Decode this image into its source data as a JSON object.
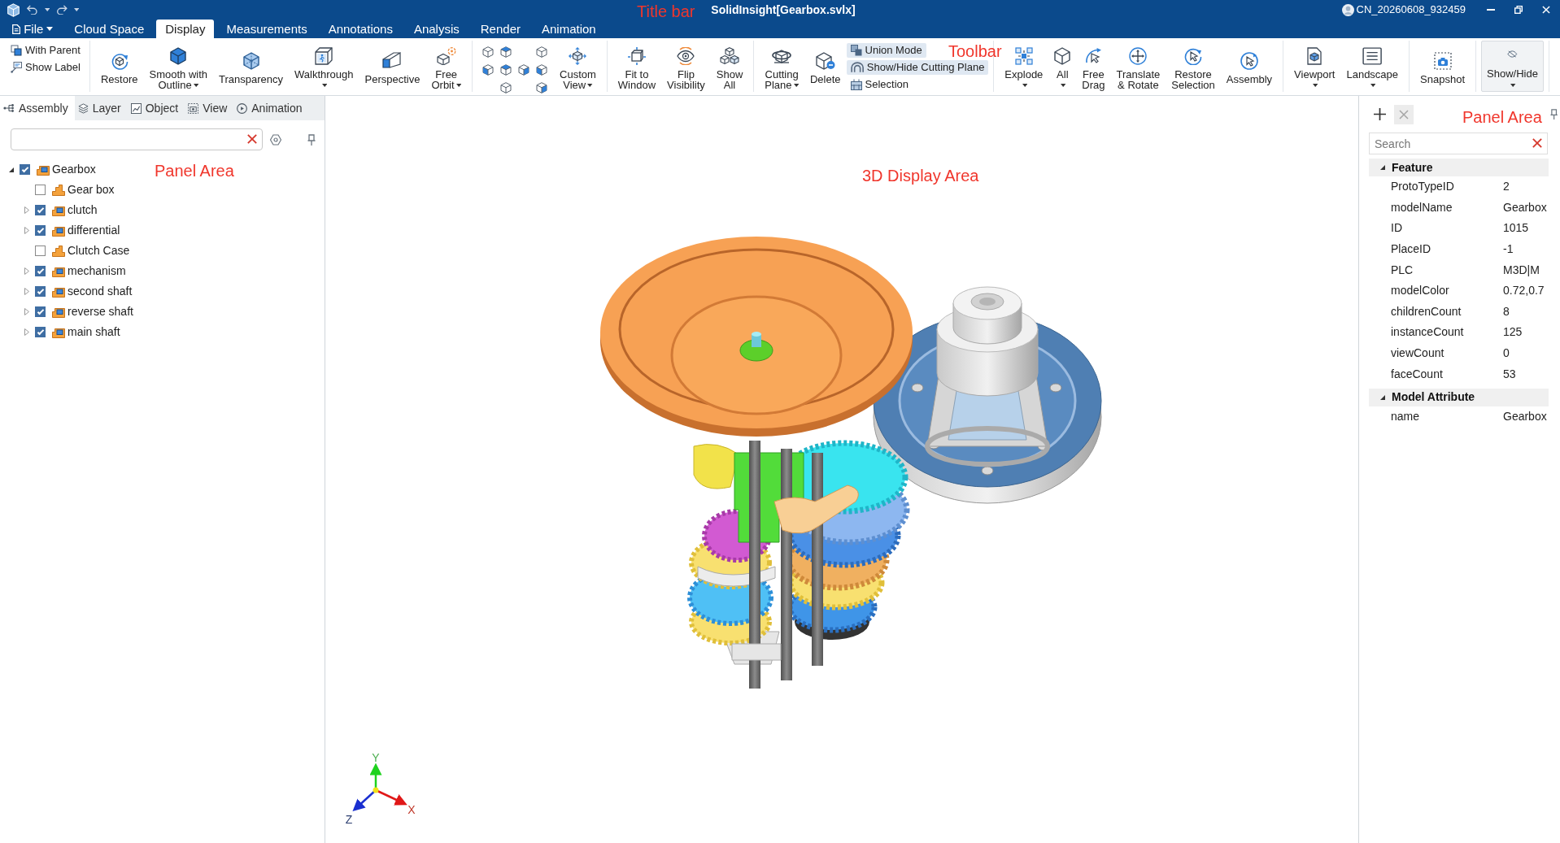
{
  "title_bar": {
    "title": "SolidInsight[Gearbox.svlx]",
    "user": "CN_20260608_932459",
    "annotation": "Title bar"
  },
  "menu_tabs": [
    {
      "label": "File",
      "kind": "file",
      "selected": false
    },
    {
      "label": "Cloud Space",
      "kind": "tab",
      "selected": false
    },
    {
      "label": "Display",
      "kind": "tab",
      "selected": true
    },
    {
      "label": "Measurements",
      "kind": "tab",
      "selected": false
    },
    {
      "label": "Annotations",
      "kind": "tab",
      "selected": false
    },
    {
      "label": "Analysis",
      "kind": "tab",
      "selected": false
    },
    {
      "label": "Render",
      "kind": "tab",
      "selected": false
    },
    {
      "label": "Animation",
      "kind": "tab",
      "selected": false
    }
  ],
  "toolbar": {
    "annotation": "Toolbar",
    "groups": [
      {
        "items": [
          {
            "kind": "small",
            "label": "With Parent",
            "on": false
          },
          {
            "kind": "small",
            "label": "Show Label",
            "on": false
          }
        ]
      },
      {
        "items": [
          {
            "kind": "large",
            "lines": [
              "Restore"
            ],
            "dropdown": false,
            "on": false
          },
          {
            "kind": "large",
            "lines": [
              "Smooth with",
              "Outline"
            ],
            "dropdown": true,
            "on": false
          },
          {
            "kind": "large",
            "lines": [
              "Transparency"
            ],
            "dropdown": false,
            "on": false
          },
          {
            "kind": "large",
            "lines": [
              "Walkthrough"
            ],
            "dropdown": true,
            "on": false
          },
          {
            "kind": "large",
            "lines": [
              "Perspective"
            ],
            "dropdown": false,
            "on": false
          },
          {
            "kind": "large",
            "lines": [
              "Free",
              "Orbit"
            ],
            "dropdown": true,
            "on": false
          }
        ]
      },
      {
        "items": [
          {
            "kind": "view-grid"
          },
          {
            "kind": "large",
            "lines": [
              "Custom",
              "View"
            ],
            "dropdown": true,
            "on": false
          }
        ]
      },
      {
        "items": [
          {
            "kind": "large",
            "lines": [
              "Fit to",
              "Window"
            ],
            "dropdown": false,
            "on": false
          },
          {
            "kind": "large",
            "lines": [
              "Flip",
              "Visibility"
            ],
            "dropdown": false,
            "on": false
          },
          {
            "kind": "large",
            "lines": [
              "Show",
              "All"
            ],
            "dropdown": false,
            "on": false
          }
        ]
      },
      {
        "items": [
          {
            "kind": "large",
            "lines": [
              "Cutting",
              "Plane"
            ],
            "dropdown": true,
            "on": false
          },
          {
            "kind": "large",
            "lines": [
              "Delete"
            ],
            "dropdown": false,
            "on": false
          },
          {
            "kind": "small",
            "label": "Union Mode",
            "on": true
          },
          {
            "kind": "small",
            "label": "Show/Hide Cutting Plane",
            "on": true
          },
          {
            "kind": "small",
            "label": "Selection",
            "on": false
          }
        ]
      },
      {
        "items": [
          {
            "kind": "large",
            "lines": [
              "Explode"
            ],
            "dropdown": true,
            "on": false
          },
          {
            "kind": "large",
            "lines": [
              "All"
            ],
            "dropdown": true,
            "on": false
          },
          {
            "kind": "large",
            "lines": [
              "Free",
              "Drag"
            ],
            "dropdown": false,
            "on": false
          },
          {
            "kind": "large",
            "lines": [
              "Translate",
              "& Rotate"
            ],
            "dropdown": false,
            "on": false
          },
          {
            "kind": "large",
            "lines": [
              "Restore",
              "Selection"
            ],
            "dropdown": false,
            "on": false
          },
          {
            "kind": "large",
            "lines": [
              "Assembly"
            ],
            "dropdown": false,
            "on": false
          }
        ]
      },
      {
        "items": [
          {
            "kind": "large",
            "lines": [
              "Viewport"
            ],
            "dropdown": true,
            "on": false
          },
          {
            "kind": "large",
            "lines": [
              "Landscape"
            ],
            "dropdown": true,
            "on": false
          }
        ]
      },
      {
        "items": [
          {
            "kind": "large",
            "lines": [
              "Snapshot"
            ],
            "dropdown": false,
            "on": false
          }
        ]
      },
      {
        "items": [
          {
            "kind": "large",
            "lines": [
              "Show/Hide"
            ],
            "dropdown": true,
            "on": true
          }
        ]
      }
    ]
  },
  "left_panel": {
    "annotation": "Panel Area",
    "tabs": [
      {
        "label": "Assembly",
        "selected": true
      },
      {
        "label": "Layer",
        "selected": false
      },
      {
        "label": "Object",
        "selected": false
      },
      {
        "label": "View",
        "selected": false
      },
      {
        "label": "Animation",
        "selected": false
      }
    ],
    "tree": [
      {
        "label": "Gearbox",
        "kind": "assembly",
        "checked": true,
        "expanded": true,
        "children": [
          {
            "label": "Gear box",
            "kind": "part",
            "checked": false
          },
          {
            "label": "clutch",
            "kind": "assembly",
            "checked": true,
            "expanded": false
          },
          {
            "label": "differential",
            "kind": "assembly",
            "checked": true,
            "expanded": false
          },
          {
            "label": "Clutch Case",
            "kind": "part",
            "checked": false
          },
          {
            "label": "mechanism",
            "kind": "assembly",
            "checked": true,
            "expanded": false
          },
          {
            "label": "second shaft",
            "kind": "assembly",
            "checked": true,
            "expanded": false
          },
          {
            "label": "reverse shaft",
            "kind": "assembly",
            "checked": true,
            "expanded": false
          },
          {
            "label": "main shaft",
            "kind": "assembly",
            "checked": true,
            "expanded": false
          }
        ]
      }
    ]
  },
  "viewport": {
    "annotation": "3D Display Area",
    "axes": {
      "x": "X",
      "y": "Y",
      "z": "Z"
    }
  },
  "right_panel": {
    "annotation": "Panel Area",
    "search": {
      "placeholder": "Search"
    },
    "sections": [
      {
        "title": "Feature",
        "expanded": true,
        "rows": [
          {
            "name": "ProtoTypeID",
            "value": "2"
          },
          {
            "name": "modelName",
            "value": "Gearbox"
          },
          {
            "name": "ID",
            "value": "1015"
          },
          {
            "name": "PlaceID",
            "value": "-1"
          },
          {
            "name": "PLC",
            "value": "M3D|M"
          },
          {
            "name": "modelColor",
            "value": "0.72,0.7"
          },
          {
            "name": "childrenCount",
            "value": "8"
          },
          {
            "name": "instanceCount",
            "value": "125"
          },
          {
            "name": "viewCount",
            "value": "0"
          },
          {
            "name": "faceCount",
            "value": "53"
          }
        ]
      },
      {
        "title": "Model Attribute",
        "expanded": true,
        "rows": [
          {
            "name": "name",
            "value": "Gearbox"
          }
        ]
      }
    ]
  }
}
